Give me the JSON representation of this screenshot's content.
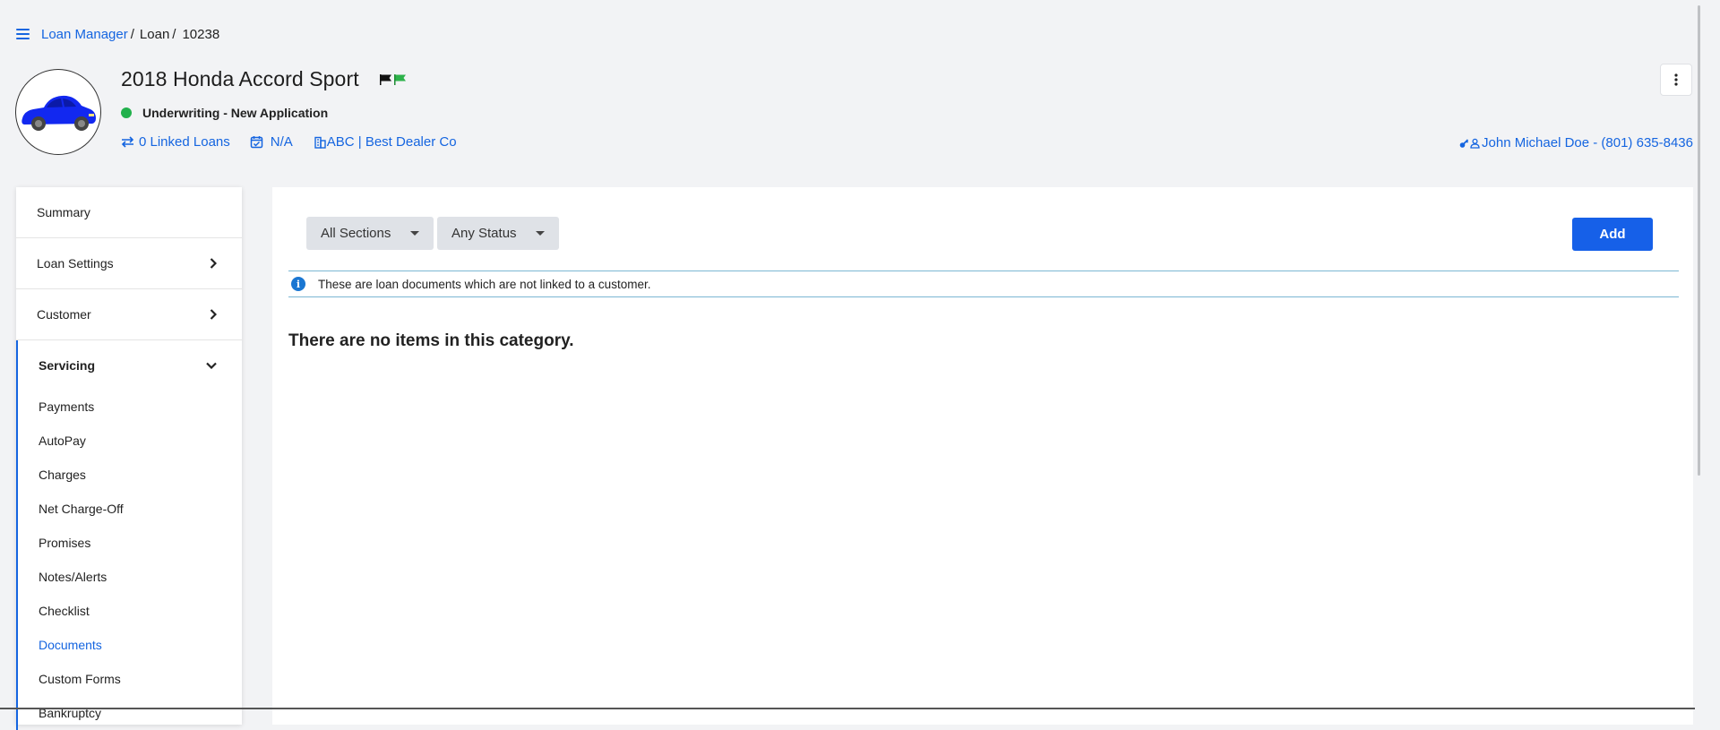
{
  "breadcrumb": {
    "root": "Loan Manager",
    "middle": "Loan",
    "current": "10238"
  },
  "header": {
    "title": "2018 Honda Accord Sport",
    "status": "Underwriting - New Application",
    "status_color": "#22b14c",
    "linked_loans": "0 Linked Loans",
    "date": "N/A",
    "dealer": "ABC | Best Dealer Co",
    "contact": "John Michael Doe - (801) 635-8436",
    "flag_colors": [
      "#111111",
      "#2db24a"
    ]
  },
  "sidebar": {
    "top_items": [
      {
        "label": "Summary"
      },
      {
        "label": "Loan Settings"
      },
      {
        "label": "Customer"
      }
    ],
    "section": {
      "label": "Servicing",
      "items": [
        {
          "label": "Payments"
        },
        {
          "label": "AutoPay"
        },
        {
          "label": "Charges"
        },
        {
          "label": "Net Charge-Off"
        },
        {
          "label": "Promises"
        },
        {
          "label": "Notes/Alerts"
        },
        {
          "label": "Checklist"
        },
        {
          "label": "Documents",
          "active": true
        },
        {
          "label": "Custom Forms"
        },
        {
          "label": "Bankruptcy"
        }
      ]
    }
  },
  "main": {
    "filter_section": "All Sections",
    "filter_status": "Any Status",
    "add_label": "Add",
    "info_text": "These are loan documents which are not linked to a customer.",
    "empty_text": "There are no items in this category."
  },
  "colors": {
    "accent": "#1565e0",
    "button": "#1660e8",
    "info_border": "#7bb7d3"
  }
}
